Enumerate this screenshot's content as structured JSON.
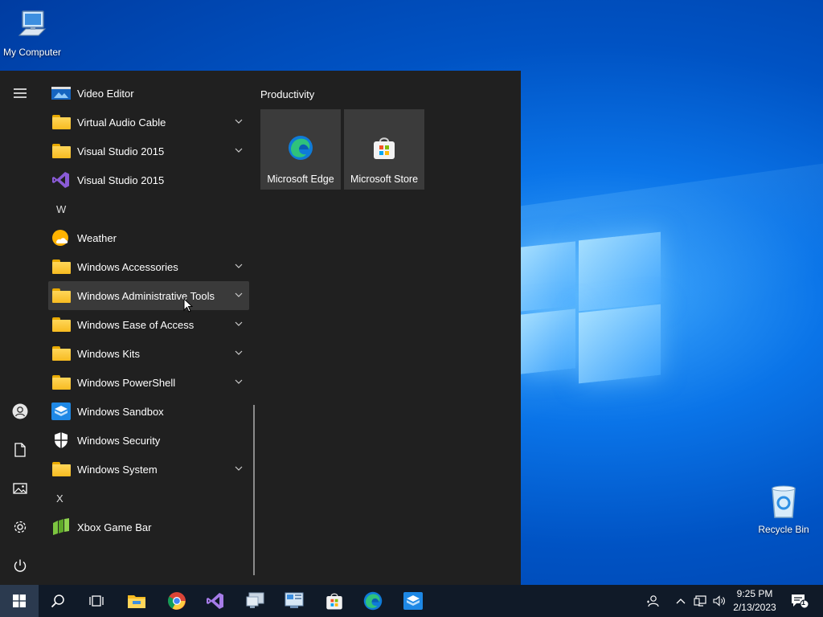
{
  "desktop": {
    "icons": [
      {
        "label": "My Computer",
        "icon": "computer-icon"
      },
      {
        "label": "Recycle Bin",
        "icon": "recycle-bin-icon"
      }
    ]
  },
  "start_menu": {
    "rail": [
      "hamburger-icon",
      "user-icon",
      "documents-icon",
      "pictures-icon",
      "settings-icon",
      "power-icon"
    ],
    "apps": [
      {
        "label": "Video Editor",
        "icon": "video-editor-icon"
      },
      {
        "label": "Virtual Audio Cable",
        "icon": "folder-icon",
        "expandable": true
      },
      {
        "label": "Visual Studio 2015",
        "icon": "folder-icon",
        "expandable": true
      },
      {
        "label": "Visual Studio 2015",
        "icon": "visual-studio-icon"
      },
      {
        "letter": "W"
      },
      {
        "label": "Weather",
        "icon": "weather-icon"
      },
      {
        "label": "Windows Accessories",
        "icon": "folder-icon",
        "expandable": true
      },
      {
        "label": "Windows Administrative Tools",
        "icon": "folder-icon",
        "expandable": true,
        "hover": true
      },
      {
        "label": "Windows Ease of Access",
        "icon": "folder-icon",
        "expandable": true
      },
      {
        "label": "Windows Kits",
        "icon": "folder-icon",
        "expandable": true
      },
      {
        "label": "Windows PowerShell",
        "icon": "folder-icon",
        "expandable": true
      },
      {
        "label": "Windows Sandbox",
        "icon": "sandbox-icon"
      },
      {
        "label": "Windows Security",
        "icon": "shield-icon"
      },
      {
        "label": "Windows System",
        "icon": "folder-icon",
        "expandable": true
      },
      {
        "letter": "X"
      },
      {
        "label": "Xbox Game Bar",
        "icon": "xbox-game-bar-icon"
      }
    ],
    "group_title": "Productivity",
    "tiles": [
      {
        "label": "Microsoft Edge",
        "icon": "edge-icon"
      },
      {
        "label": "Microsoft Store",
        "icon": "store-icon"
      }
    ]
  },
  "taskbar": {
    "pinned": [
      "windows-start-icon",
      "search-icon",
      "task-view-icon",
      "file-explorer-icon",
      "chrome-icon",
      "visual-studio-icon",
      "remote-desktop-icon",
      "control-panel-icon",
      "store-icon",
      "edge-icon",
      "sandbox-icon"
    ],
    "tray": [
      "people-icon",
      "chevron-up-icon",
      "network-icon",
      "volume-icon"
    ],
    "time": "9:25 PM",
    "date": "2/13/2023",
    "notification_count": "1"
  },
  "colors": {
    "menu_bg": "#202020",
    "tile_bg": "#3b3b3b",
    "taskbar_bg": "#101a28",
    "hover_bg": "#3a3a3a",
    "folder": "#ffc83d"
  }
}
